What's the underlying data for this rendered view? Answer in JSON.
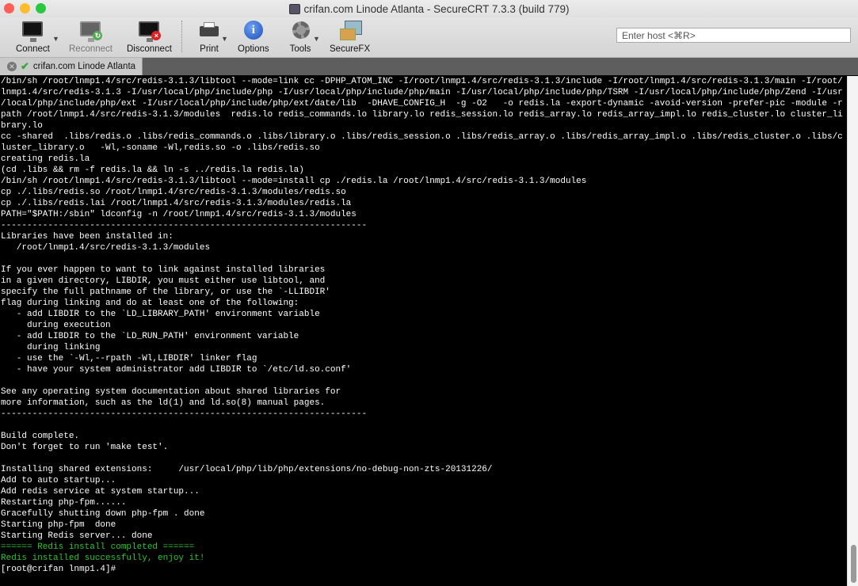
{
  "window": {
    "title": "crifan.com Linode Atlanta - SecureCRT 7.3.3 (build 779)"
  },
  "toolbar": {
    "connect": "Connect",
    "reconnect": "Reconnect",
    "disconnect": "Disconnect",
    "print": "Print",
    "options": "Options",
    "tools": "Tools",
    "securefx": "SecureFX",
    "host_placeholder": "Enter host <⌘R>"
  },
  "tab": {
    "label": "crifan.com Linode Atlanta"
  },
  "colors": {
    "terminal_bg": "#000000",
    "terminal_fg": "#ffffff",
    "success": "#2ec52e"
  },
  "terminal": {
    "lines": [
      {
        "t": "/bin/sh /root/lnmp1.4/src/redis-3.1.3/libtool --mode=link cc -DPHP_ATOM_INC -I/root/lnmp1.4/src/redis-3.1.3/include -I/root/lnmp1.4/src/redis-3.1.3/main -I/root/"
      },
      {
        "t": "lnmp1.4/src/redis-3.1.3 -I/usr/local/php/include/php -I/usr/local/php/include/php/main -I/usr/local/php/include/php/TSRM -I/usr/local/php/include/php/Zend -I/usr"
      },
      {
        "t": "/local/php/include/php/ext -I/usr/local/php/include/php/ext/date/lib  -DHAVE_CONFIG_H  -g -O2   -o redis.la -export-dynamic -avoid-version -prefer-pic -module -r"
      },
      {
        "t": "path /root/lnmp1.4/src/redis-3.1.3/modules  redis.lo redis_commands.lo library.lo redis_session.lo redis_array.lo redis_array_impl.lo redis_cluster.lo cluster_li"
      },
      {
        "t": "brary.lo"
      },
      {
        "t": "cc -shared  .libs/redis.o .libs/redis_commands.o .libs/library.o .libs/redis_session.o .libs/redis_array.o .libs/redis_array_impl.o .libs/redis_cluster.o .libs/c"
      },
      {
        "t": "luster_library.o   -Wl,-soname -Wl,redis.so -o .libs/redis.so"
      },
      {
        "t": "creating redis.la"
      },
      {
        "t": "(cd .libs && rm -f redis.la && ln -s ../redis.la redis.la)"
      },
      {
        "t": "/bin/sh /root/lnmp1.4/src/redis-3.1.3/libtool --mode=install cp ./redis.la /root/lnmp1.4/src/redis-3.1.3/modules"
      },
      {
        "t": "cp ./.libs/redis.so /root/lnmp1.4/src/redis-3.1.3/modules/redis.so"
      },
      {
        "t": "cp ./.libs/redis.lai /root/lnmp1.4/src/redis-3.1.3/modules/redis.la"
      },
      {
        "t": "PATH=\"$PATH:/sbin\" ldconfig -n /root/lnmp1.4/src/redis-3.1.3/modules"
      },
      {
        "t": "----------------------------------------------------------------------"
      },
      {
        "t": "Libraries have been installed in:"
      },
      {
        "t": "   /root/lnmp1.4/src/redis-3.1.3/modules"
      },
      {
        "t": ""
      },
      {
        "t": "If you ever happen to want to link against installed libraries"
      },
      {
        "t": "in a given directory, LIBDIR, you must either use libtool, and"
      },
      {
        "t": "specify the full pathname of the library, or use the `-LLIBDIR'"
      },
      {
        "t": "flag during linking and do at least one of the following:"
      },
      {
        "t": "   - add LIBDIR to the `LD_LIBRARY_PATH' environment variable"
      },
      {
        "t": "     during execution"
      },
      {
        "t": "   - add LIBDIR to the `LD_RUN_PATH' environment variable"
      },
      {
        "t": "     during linking"
      },
      {
        "t": "   - use the `-Wl,--rpath -Wl,LIBDIR' linker flag"
      },
      {
        "t": "   - have your system administrator add LIBDIR to `/etc/ld.so.conf'"
      },
      {
        "t": ""
      },
      {
        "t": "See any operating system documentation about shared libraries for"
      },
      {
        "t": "more information, such as the ld(1) and ld.so(8) manual pages."
      },
      {
        "t": "----------------------------------------------------------------------"
      },
      {
        "t": ""
      },
      {
        "t": "Build complete."
      },
      {
        "t": "Don't forget to run 'make test'."
      },
      {
        "t": ""
      },
      {
        "t": "Installing shared extensions:     /usr/local/php/lib/php/extensions/no-debug-non-zts-20131226/"
      },
      {
        "t": "Add to auto startup..."
      },
      {
        "t": "Add redis service at system startup..."
      },
      {
        "t": "Restarting php-fpm......"
      },
      {
        "t": "Gracefully shutting down php-fpm . done"
      },
      {
        "t": "Starting php-fpm  done"
      },
      {
        "t": "Starting Redis server... done"
      },
      {
        "t": "====== Redis install completed ======",
        "green": true
      },
      {
        "t": "Redis installed successfully, enjoy it!",
        "green": true
      },
      {
        "t": "[root@crifan lnmp1.4]# "
      }
    ]
  }
}
